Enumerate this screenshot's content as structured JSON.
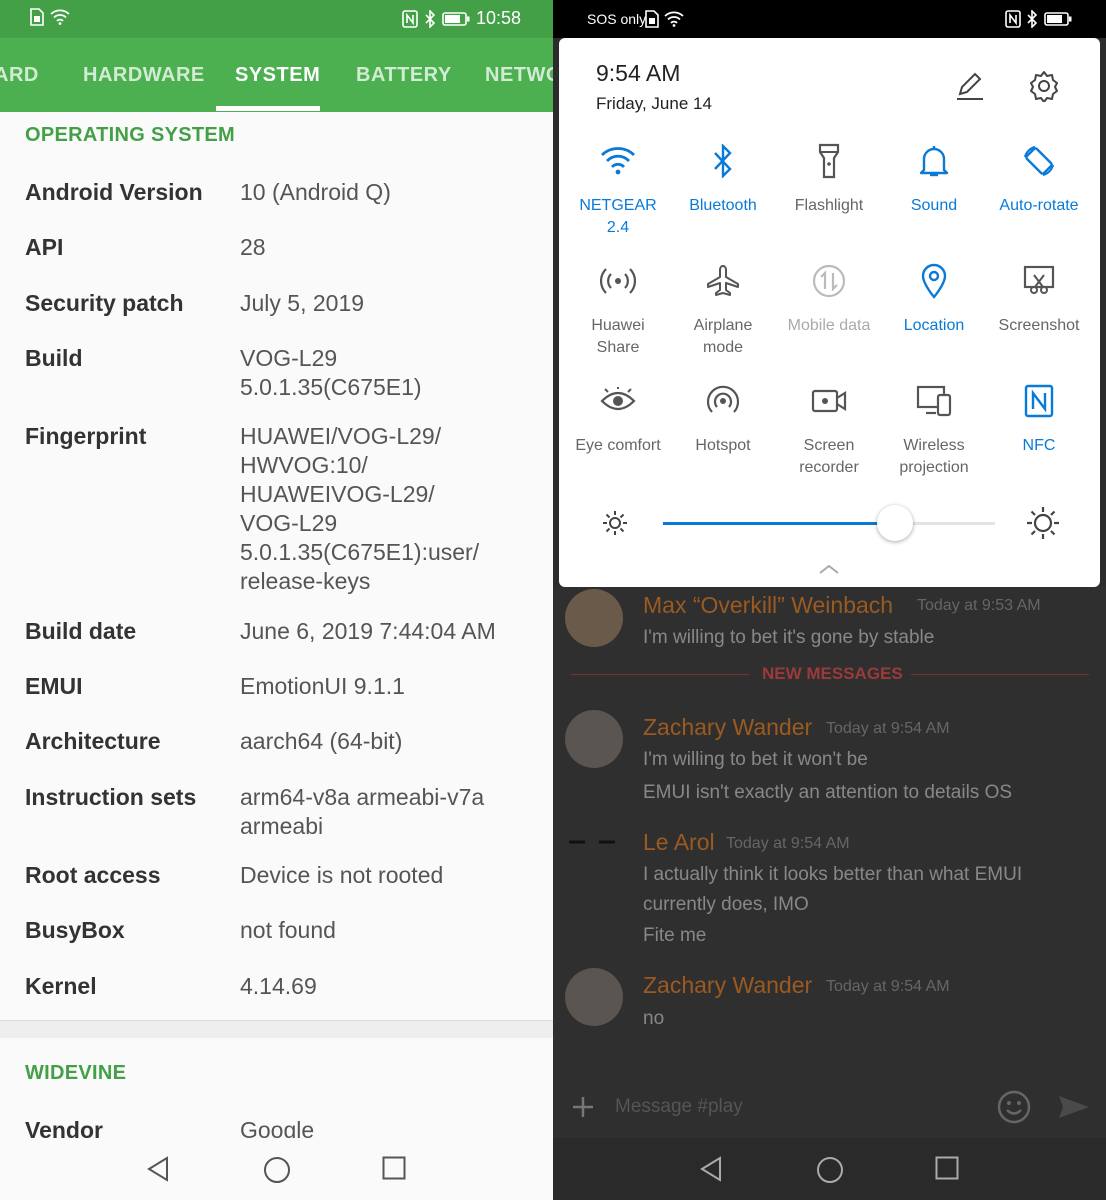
{
  "left": {
    "status_time": "10:58",
    "tabs": [
      "ARD",
      "HARDWARE",
      "SYSTEM",
      "BATTERY",
      "NETWO"
    ],
    "active_tab": "SYSTEM",
    "os_section": "OPERATING SYSTEM",
    "rows": [
      {
        "label": "Android Version",
        "value": "10 (Android Q)"
      },
      {
        "label": "API",
        "value": "28"
      },
      {
        "label": "Security patch",
        "value": "July 5, 2019"
      },
      {
        "label": "Build",
        "value": "VOG-L29\n5.0.1.35(C675E1)"
      },
      {
        "label": "Fingerprint",
        "value": "HUAWEI/VOG-L29/\nHWVOG:10/\nHUAWEIVOG-L29/\nVOG-L29\n5.0.1.35(C675E1):user/\nrelease-keys"
      },
      {
        "label": "Build date",
        "value": "June 6, 2019 7:44:04 AM"
      },
      {
        "label": "EMUI",
        "value": "EmotionUI 9.1.1"
      },
      {
        "label": "Architecture",
        "value": "aarch64 (64-bit)"
      },
      {
        "label": "Instruction sets",
        "value": "arm64-v8a armeabi-v7a\narmeabi"
      },
      {
        "label": "Root access",
        "value": "Device is not rooted"
      },
      {
        "label": "BusyBox",
        "value": "not found"
      },
      {
        "label": "Kernel",
        "value": "4.14.69"
      }
    ],
    "widevine_section": "WIDEVINE",
    "widevine_rows": [
      {
        "label": "Vendor",
        "value": "Google"
      }
    ]
  },
  "right": {
    "status_carrier": "SOS only",
    "shade": {
      "time": "9:54 AM",
      "date": "Friday, June 14",
      "tiles": [
        {
          "label": "NETGEAR\n2.4",
          "icon": "wifi-icon",
          "state": "on"
        },
        {
          "label": "Bluetooth",
          "icon": "bluetooth-icon",
          "state": "on"
        },
        {
          "label": "Flashlight",
          "icon": "flashlight-icon",
          "state": "off"
        },
        {
          "label": "Sound",
          "icon": "bell-icon",
          "state": "on"
        },
        {
          "label": "Auto-rotate",
          "icon": "auto-rotate-icon",
          "state": "on"
        },
        {
          "label": "Huawei\nShare",
          "icon": "huawei-share-icon",
          "state": "off"
        },
        {
          "label": "Airplane\nmode",
          "icon": "airplane-icon",
          "state": "off"
        },
        {
          "label": "Mobile data",
          "icon": "mobile-data-icon",
          "state": "dim"
        },
        {
          "label": "Location",
          "icon": "location-icon",
          "state": "on"
        },
        {
          "label": "Screenshot",
          "icon": "screenshot-icon",
          "state": "off"
        },
        {
          "label": "Eye comfort",
          "icon": "eye-icon",
          "state": "off"
        },
        {
          "label": "Hotspot",
          "icon": "hotspot-icon",
          "state": "off"
        },
        {
          "label": "Screen\nrecorder",
          "icon": "screen-recorder-icon",
          "state": "off"
        },
        {
          "label": "Wireless\nprojection",
          "icon": "wireless-projection-icon",
          "state": "off"
        },
        {
          "label": "NFC",
          "icon": "nfc-icon",
          "state": "on"
        }
      ],
      "brightness": 0.7
    },
    "chat": {
      "messages": [
        {
          "name": "Max “Overkill” Weinbach",
          "time": "Today at 9:53 AM",
          "lines": [
            "I'm willing to bet it's gone by stable"
          ]
        },
        {
          "name": "Zachary Wander",
          "time": "Today at 9:54 AM",
          "lines": [
            "I'm willing to bet it won't be",
            "EMUI isn't exactly an attention to details OS"
          ]
        },
        {
          "name": "Le Arol",
          "time": "Today at 9:54 AM",
          "lines": [
            "I actually think it looks better than what EMUI",
            "currently does, IMO",
            "Fite me"
          ]
        },
        {
          "name": "Zachary Wander",
          "time": "Today at 9:54 AM",
          "lines": [
            "no"
          ]
        }
      ],
      "new_messages_label": "NEW MESSAGES",
      "input_placeholder": "Message #play"
    }
  },
  "colors": {
    "green_dark": "#43a047",
    "green": "#4caf50",
    "accent_blue": "#0a7ad8"
  }
}
